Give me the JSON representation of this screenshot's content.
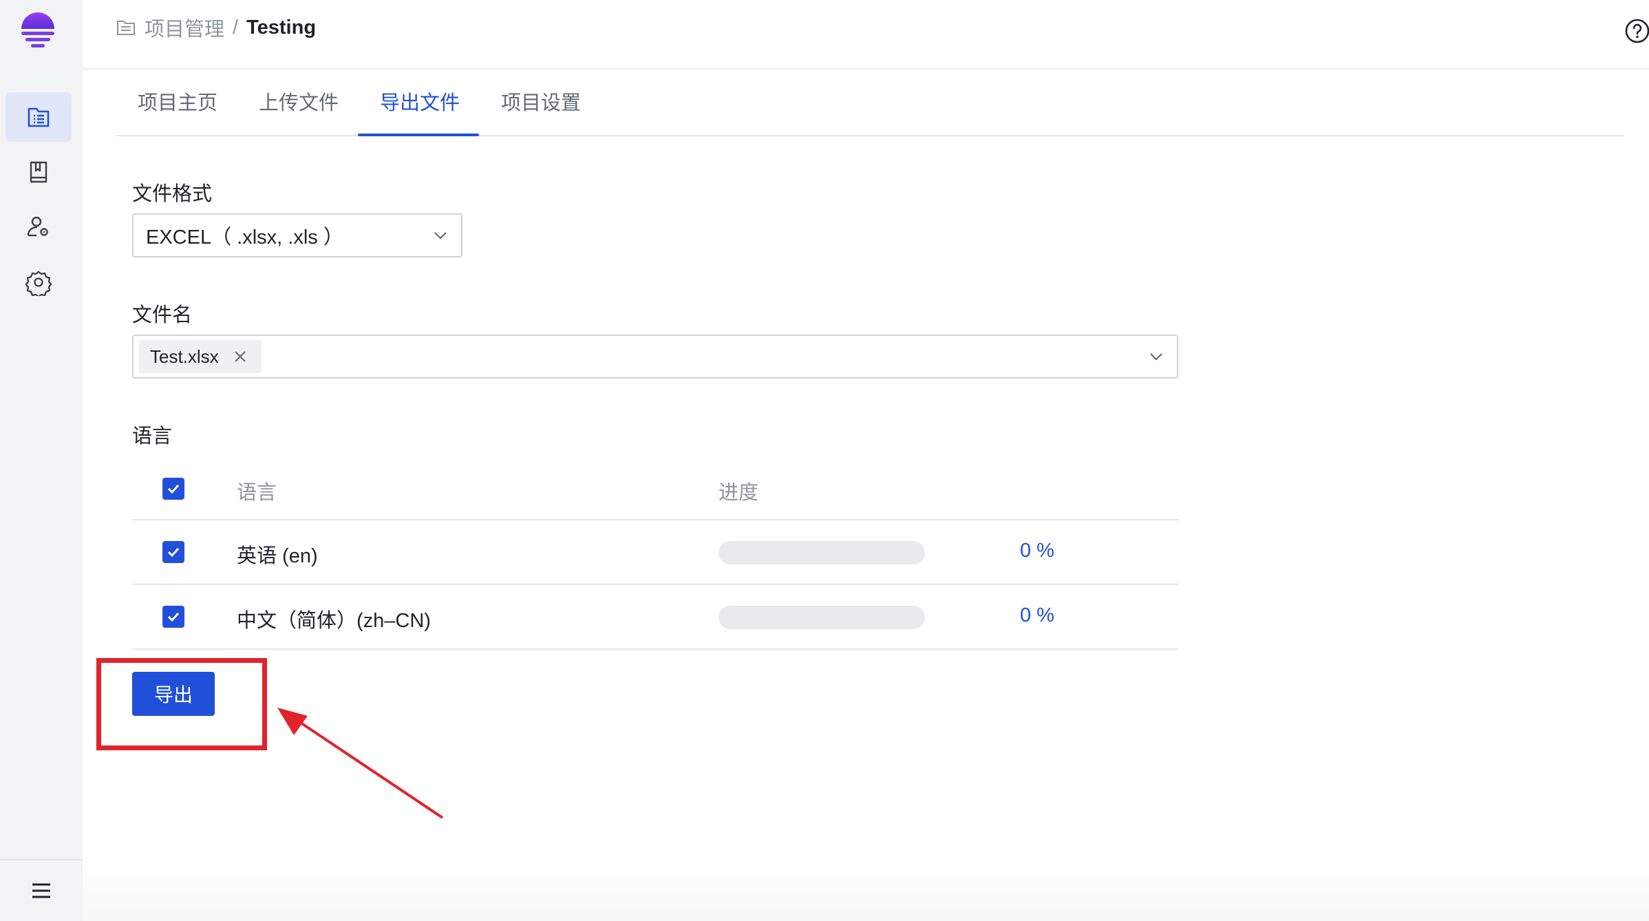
{
  "header": {
    "breadcrumb_parent": "项目管理",
    "breadcrumb_separator": "/",
    "breadcrumb_current": "Testing"
  },
  "tabs": [
    {
      "label": "项目主页",
      "active": false
    },
    {
      "label": "上传文件",
      "active": false
    },
    {
      "label": "导出文件",
      "active": true
    },
    {
      "label": "项目设置",
      "active": false
    }
  ],
  "form": {
    "format_label": "文件格式",
    "format_value": "EXCEL（ .xlsx, .xls ）",
    "filename_label": "文件名",
    "filename_tag": "Test.xlsx",
    "language_label": "语言"
  },
  "language_table": {
    "headers": {
      "language": "语言",
      "progress": "进度"
    },
    "header_checked": true,
    "rows": [
      {
        "language": "英语 (en)",
        "checked": true,
        "progress": 0,
        "progress_text": "0 %"
      },
      {
        "language": "中文（简体）(zh–CN)",
        "checked": true,
        "progress": 0,
        "progress_text": "0 %"
      }
    ]
  },
  "actions": {
    "export_label": "导出"
  },
  "colors": {
    "accent": "#2150d8",
    "sidebar_bg": "#f2f3f5",
    "sidebar_active": "#e1e7f9",
    "annotation_red": "#e1232b",
    "logo_purple": "#7b3fe4"
  },
  "icons": {
    "logo": "brand-logo",
    "sidebar": [
      "project-list-icon",
      "book-icon",
      "user-settings-icon",
      "gear-icon"
    ],
    "sidebar_bottom": "menu-icon",
    "help": "help-icon",
    "breadcrumb": "folder-icon"
  }
}
